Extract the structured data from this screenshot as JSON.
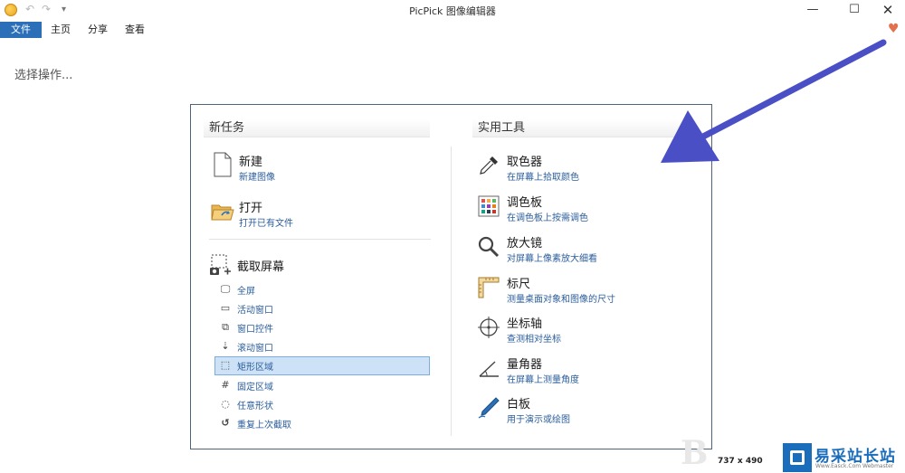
{
  "window": {
    "title": "PicPick 图像编辑器",
    "controls": {
      "minimize": "—",
      "maximize": "☐",
      "close": "✕"
    },
    "quick_access": {
      "undo": "↶",
      "redo": "↷",
      "more": "▾"
    }
  },
  "menu": {
    "tabs": [
      {
        "label": "文件",
        "active": true
      },
      {
        "label": "主页",
        "active": false
      },
      {
        "label": "分享",
        "active": false
      },
      {
        "label": "查看",
        "active": false
      }
    ]
  },
  "prompt": "选择操作...",
  "new_tasks": {
    "heading": "新任务",
    "new_item": {
      "title": "新建",
      "desc": "新建图像"
    },
    "open_item": {
      "title": "打开",
      "desc": "打开已有文件"
    },
    "capture": {
      "title": "截取屏幕",
      "items": [
        {
          "label": "全屏",
          "icon": "monitor-icon"
        },
        {
          "label": "活动窗口",
          "icon": "window-icon"
        },
        {
          "label": "窗口控件",
          "icon": "window-control-icon"
        },
        {
          "label": "滚动窗口",
          "icon": "scroll-window-icon"
        },
        {
          "label": "矩形区域",
          "icon": "rectangle-region-icon",
          "selected": true
        },
        {
          "label": "固定区域",
          "icon": "fixed-region-icon"
        },
        {
          "label": "任意形状",
          "icon": "freeform-icon"
        },
        {
          "label": "重复上次截取",
          "icon": "repeat-icon"
        }
      ]
    }
  },
  "tools": {
    "heading": "实用工具",
    "items": [
      {
        "title": "取色器",
        "desc": "在屏幕上拾取颜色",
        "icon": "eyedropper-icon"
      },
      {
        "title": "调色板",
        "desc": "在调色板上按需调色",
        "icon": "palette-icon"
      },
      {
        "title": "放大镜",
        "desc": "对屏幕上像素放大细看",
        "icon": "magnifier-icon"
      },
      {
        "title": "标尺",
        "desc": "测量桌面对象和图像的尺寸",
        "icon": "ruler-icon"
      },
      {
        "title": "坐标轴",
        "desc": "查测相对坐标",
        "icon": "crosshair-icon"
      },
      {
        "title": "量角器",
        "desc": "在屏幕上测量角度",
        "icon": "protractor-icon"
      },
      {
        "title": "白板",
        "desc": "用于演示或绘图",
        "icon": "whiteboard-pen-icon"
      }
    ]
  },
  "status": {
    "dimensions": "737 x 490"
  },
  "watermark": {
    "name": "易采站长站",
    "url": "Www.Easck.Com Webmaster"
  },
  "colors": {
    "accent": "#2b6fb8",
    "link": "#2a5d9c",
    "arrow": "#4a4fc6",
    "heart": "#e3714d"
  }
}
